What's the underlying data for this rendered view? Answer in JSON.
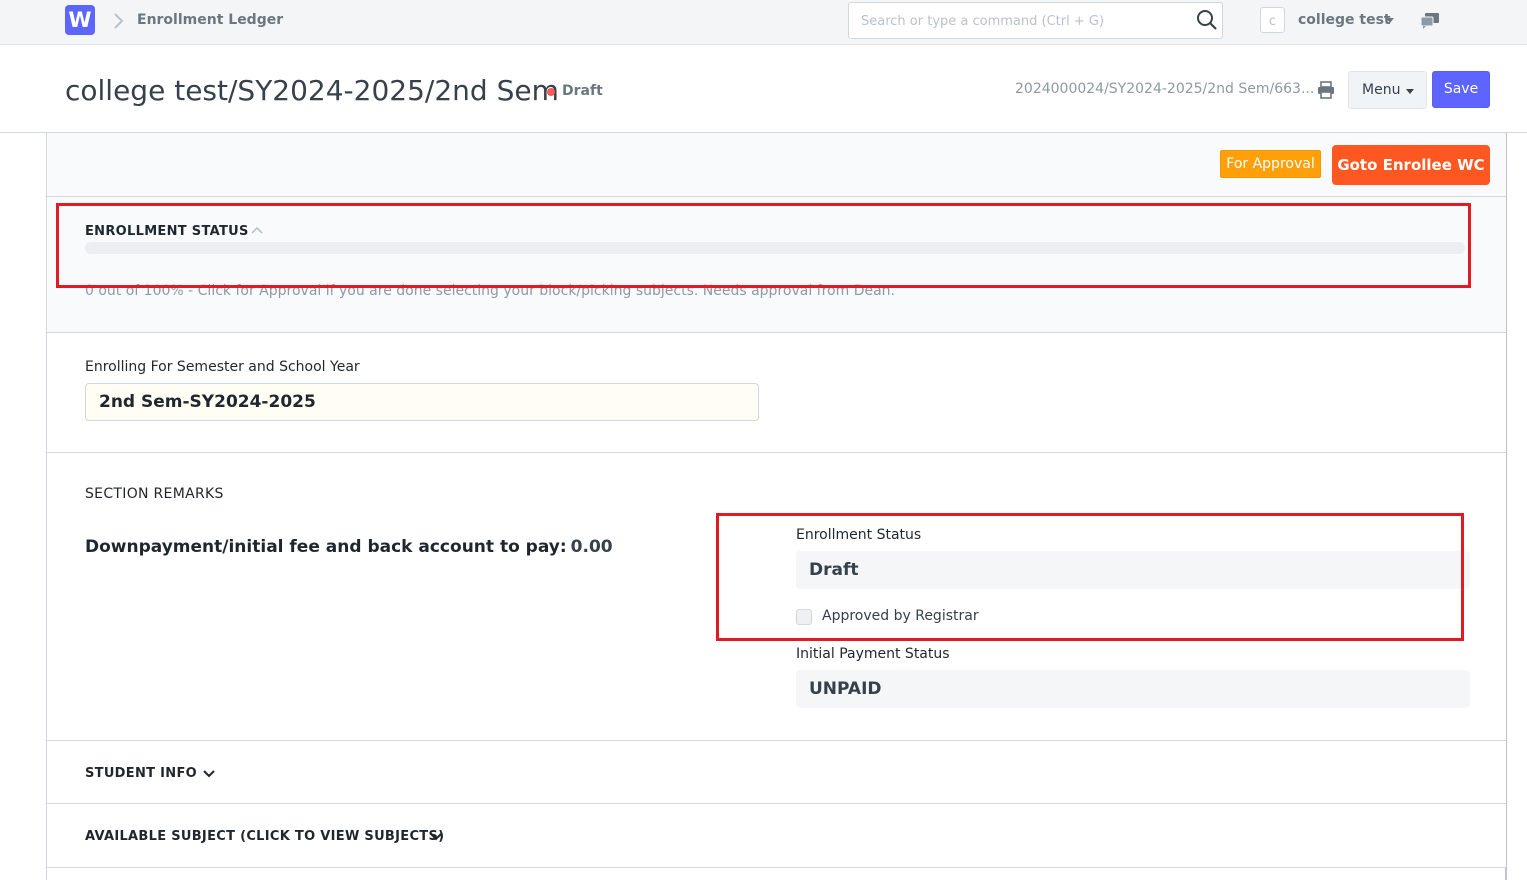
{
  "navbar": {
    "logo_letter": "W",
    "breadcrumb": "Enrollment Ledger",
    "search_placeholder": "Search or type a command (Ctrl + G)",
    "avatar_letter": "c",
    "user_name": "college test"
  },
  "header": {
    "title": "college test/SY2024-2025/2nd Sem",
    "status": "Draft",
    "status_color": "#ff5858",
    "doc_name": "2024000024/SY2024-2025/2nd Sem/663...",
    "menu_label": "Menu",
    "save_label": "Save"
  },
  "actions": {
    "for_approval_label": "For Approval",
    "goto_label": "Goto Enrollee WC"
  },
  "enrollment_status_section": {
    "title": "ENROLLMENT STATUS",
    "progress_percent": 0,
    "note": "0 out of 100% - Click for Approval if you are done selecting your block/picking subjects. Needs approval from Dean."
  },
  "semester_section": {
    "label": "Enrolling For Semester and School Year",
    "value": "2nd Sem-SY2024-2025"
  },
  "remarks_section": {
    "title": "SECTION REMARKS",
    "downpayment_label": "Downpayment/initial fee and back account to pay:",
    "downpayment_value": "0.00",
    "enrollment_status_label": "Enrollment Status",
    "enrollment_status_value": "Draft",
    "approved_label": "Approved by Registrar",
    "approved_checked": false,
    "payment_status_label": "Initial Payment Status",
    "payment_status_value": "UNPAID"
  },
  "collapsed_sections": {
    "student_info": "STUDENT INFO",
    "available_subject": "AVAILABLE SUBJECT (CLICK TO VIEW SUBJECTS)"
  },
  "colors": {
    "primary": "#5e64ff",
    "for_approval": "#ffa00a",
    "goto": "#ff5722",
    "highlight": "#e01b24"
  }
}
